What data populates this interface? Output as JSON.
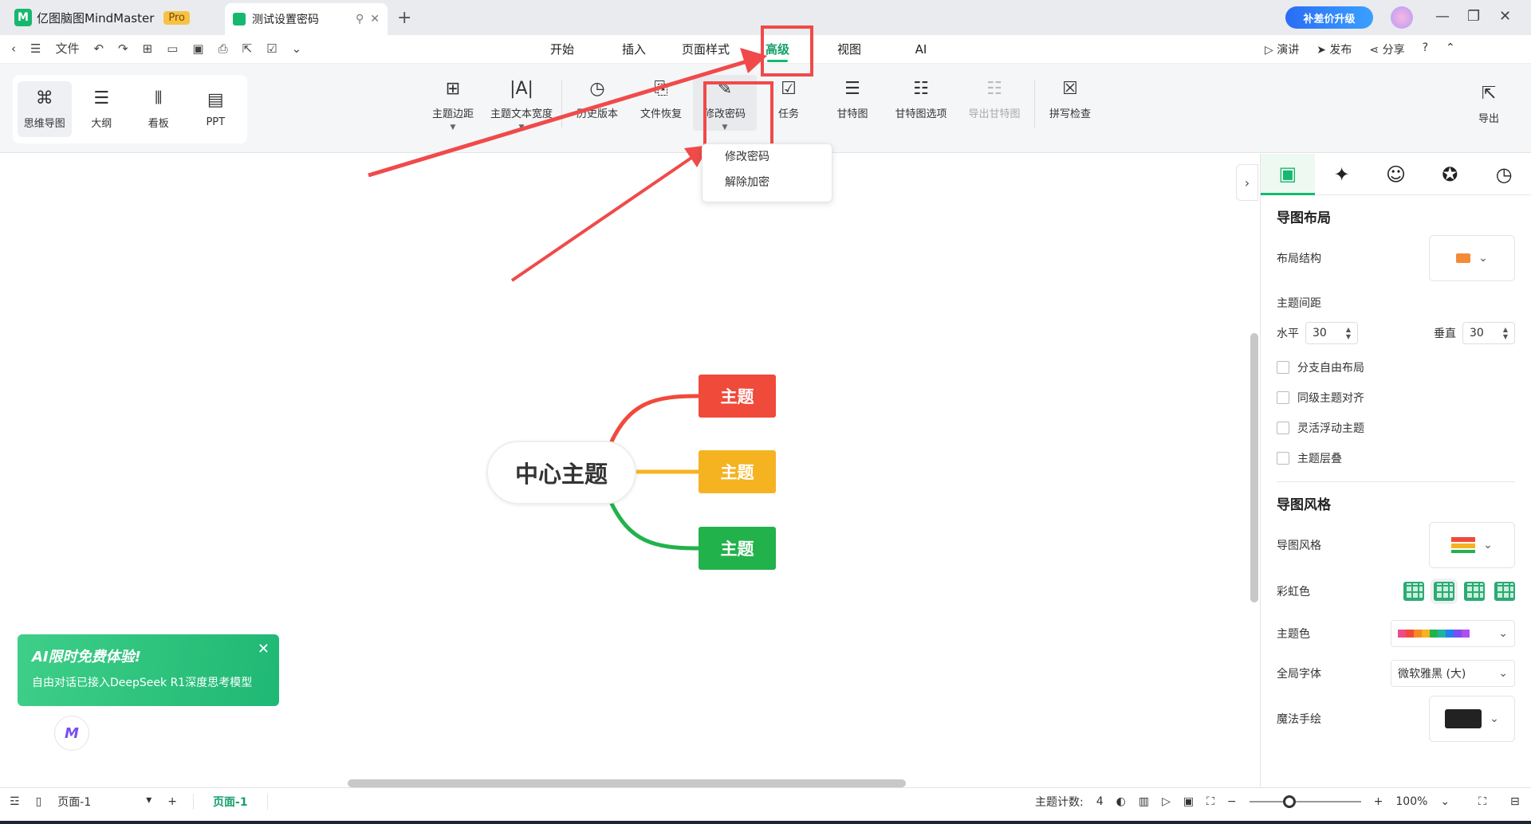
{
  "titlebar": {
    "app_name": "亿图脑图MindMaster",
    "pro": "Pro",
    "doc_tab": "测试设置密码",
    "upgrade": "补差价升级"
  },
  "menu": {
    "file": "文件",
    "tabs": [
      "开始",
      "插入",
      "页面样式",
      "高级",
      "视图",
      "AI"
    ],
    "right": [
      "演讲",
      "发布",
      "分享"
    ]
  },
  "views": [
    "思维导图",
    "大纲",
    "看板",
    "PPT"
  ],
  "tools": [
    "主题边距",
    "主题文本宽度",
    "历史版本",
    "文件恢复",
    "修改密码",
    "任务",
    "甘特图",
    "甘特图选项",
    "导出甘特图",
    "拼写检查"
  ],
  "export": "导出",
  "dropdown": [
    "修改密码",
    "解除加密"
  ],
  "canvas": {
    "center": "中心主题",
    "topics": [
      "主题",
      "主题",
      "主题"
    ]
  },
  "ai_promo": {
    "title": "AI限时免费体验!",
    "subtitle": "自由对话已接入DeepSeek R1深度思考模型"
  },
  "panel": {
    "layout_title": "导图布局",
    "layout_structure": "布局结构",
    "topic_spacing": "主题间距",
    "horizontal": "水平",
    "horizontal_value": "30",
    "vertical": "垂直",
    "vertical_value": "30",
    "checkboxes": [
      "分支自由布局",
      "同级主题对齐",
      "灵活浮动主题",
      "主题层叠"
    ],
    "style_title": "导图风格",
    "style_label": "导图风格",
    "rainbow": "彩虹色",
    "theme_color": "主题色",
    "global_font": "全局字体",
    "font_value": "微软雅黑 (大)",
    "magic": "魔法手绘"
  },
  "status": {
    "page": "页面-1",
    "page_tab": "页面-1",
    "topic_count_label": "主题计数:",
    "topic_count": "4",
    "zoom": "100%"
  },
  "colors": {
    "accent": "#16b86f",
    "red": "#f04a3b",
    "yellow": "#f5b322",
    "green": "#22b24c",
    "annotation": "#f04a4a"
  }
}
